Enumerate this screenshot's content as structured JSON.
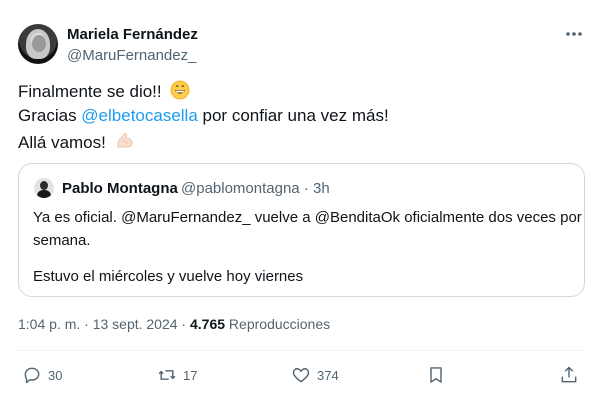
{
  "author": {
    "name": "Mariela Fernández",
    "handle": "@MaruFernandez_"
  },
  "tweet": {
    "line1": "Finalmente se dio!!",
    "line2_prefix": "Gracias ",
    "line2_mention": "@elbetocasella",
    "line2_suffix": " por confiar una vez más!",
    "line3": "Allá vamos!",
    "emoji_grin": "grinning-face-icon",
    "emoji_muscle": "flexed-biceps-icon"
  },
  "quote": {
    "name": "Pablo Montagna",
    "meta": "@pablomontagna · 3h",
    "line1": "Ya es oficial. @MaruFernandez_ vuelve a @BenditaOk oficialmente dos veces por",
    "line2": "semana.",
    "line3": "Estuvo el miércoles y vuelve hoy viernes"
  },
  "meta": {
    "time": "1:04 p. m. · 13 sept. 2024 · ",
    "views_count": "4.765",
    "views_label": " Reproducciones"
  },
  "actions": {
    "replies": "30",
    "reposts": "17",
    "likes": "374"
  },
  "colors": {
    "accent": "#1d9bf0",
    "text": "#0f1419",
    "secondary": "#536471",
    "border": "#cfd9de"
  }
}
